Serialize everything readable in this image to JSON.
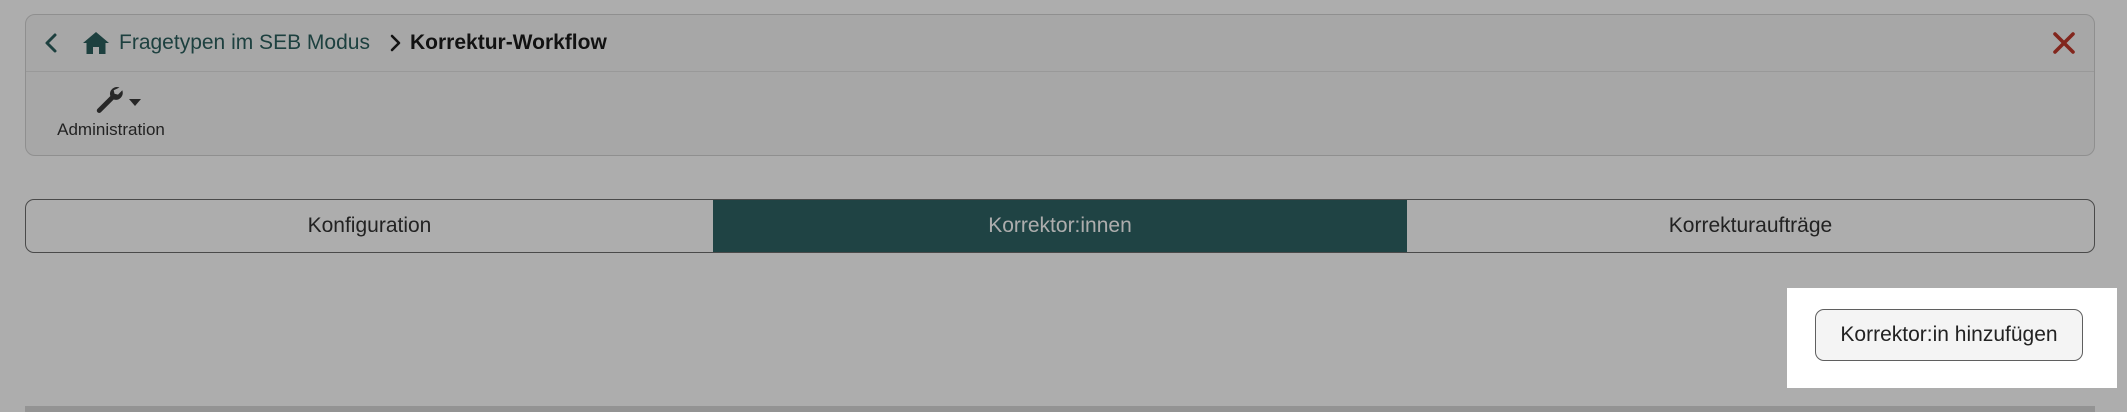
{
  "breadcrumb": {
    "parent_label": "Fragetypen im SEB Modus",
    "current_label": "Korrektur-Workflow"
  },
  "toolbar": {
    "admin_label": "Administration",
    "admin_icon": "wrench-icon"
  },
  "tabs": [
    {
      "label": "Konfiguration",
      "active": false
    },
    {
      "label": "Korrektor:innen",
      "active": true
    },
    {
      "label": "Korrekturaufträge",
      "active": false
    }
  ],
  "actions": {
    "add_corrector_label": "Korrektor:in hinzufügen"
  },
  "colors": {
    "accent": "#2e6465",
    "link": "#2b5f5e",
    "close": "#c0392b",
    "overlay": "rgba(0,0,0,0.32)"
  }
}
